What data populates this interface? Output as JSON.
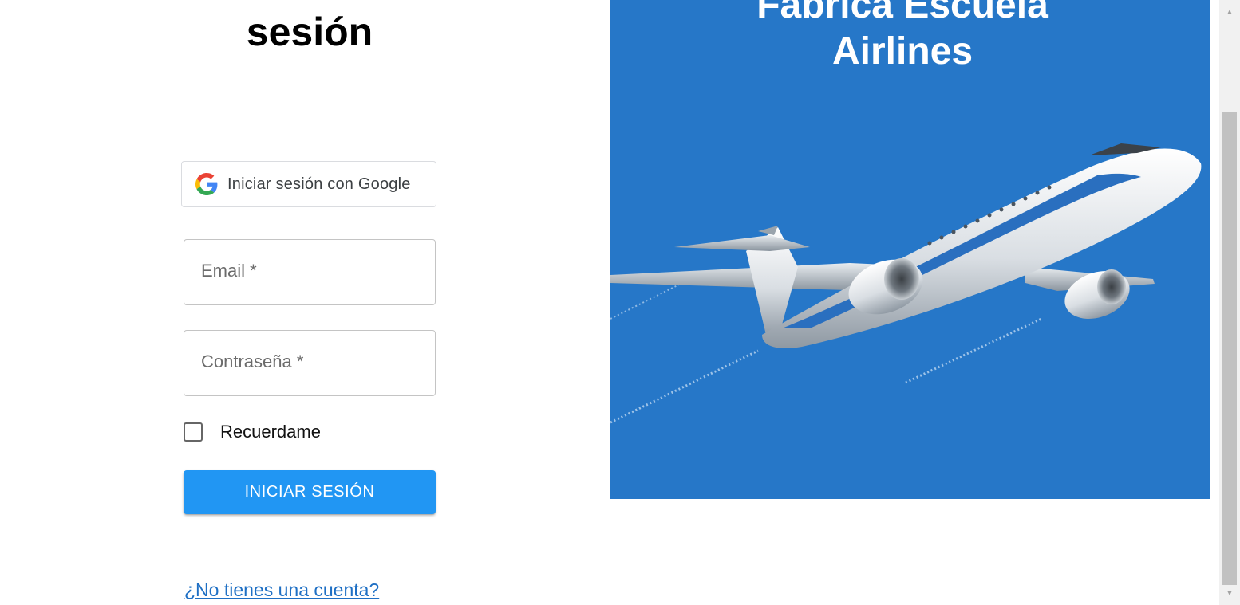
{
  "login": {
    "title": "sesión",
    "google_button_label": "Iniciar sesión con Google",
    "email_label": "Email *",
    "email_value": "",
    "password_label": "Contraseña *",
    "password_value": "",
    "remember_label": "Recuerdame",
    "remember_checked": false,
    "submit_label": "INICIAR SESIÓN",
    "signup_link": "¿No tienes una cuenta?"
  },
  "promo": {
    "title_line1": "Fabrica Escuela",
    "title_line2": "Airlines",
    "background_color": "#2677c8",
    "image": "airplane-illustration"
  },
  "colors": {
    "primary_button": "#2196f3",
    "link": "#1e6fc4"
  },
  "icons": {
    "google": "google-icon",
    "checkbox": "checkbox-icon",
    "scroll_up": "scroll-up-arrow-icon",
    "scroll_down": "scroll-down-arrow-icon"
  }
}
